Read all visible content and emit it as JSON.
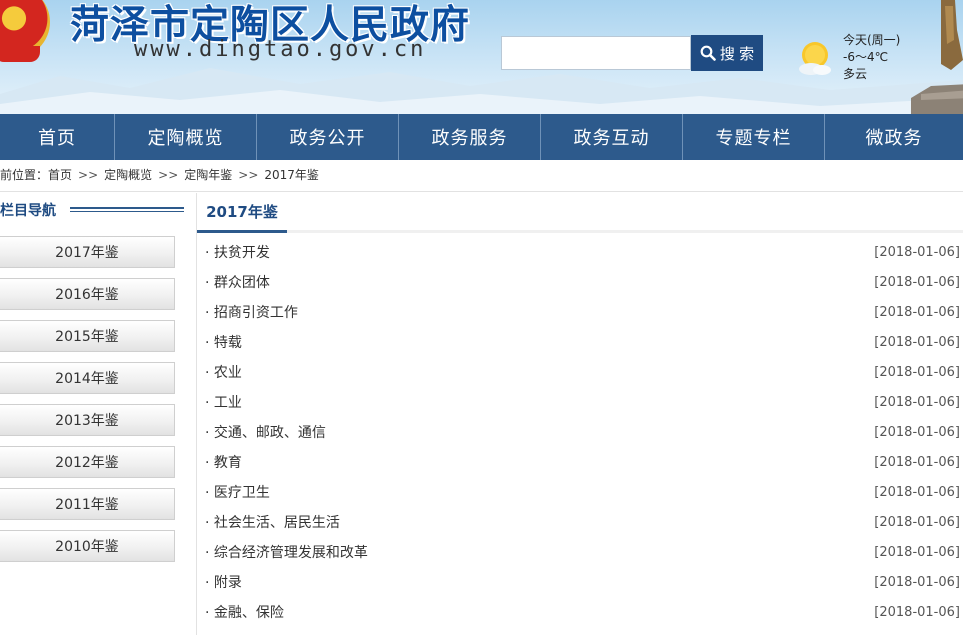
{
  "header": {
    "site_title": "菏泽市定陶区人民政府",
    "site_url": "www.dingtao.gov.cn",
    "search": {
      "placeholder": "",
      "button_label": "搜 索"
    },
    "weather": {
      "day": "今天(周一)",
      "temp": "-6～4℃",
      "condition": "多云",
      "icon": "partly-cloudy-sun-icon"
    }
  },
  "nav": {
    "items": [
      {
        "label": "首页"
      },
      {
        "label": "定陶概览"
      },
      {
        "label": "政务公开"
      },
      {
        "label": "政务服务"
      },
      {
        "label": "政务互动"
      },
      {
        "label": "专题专栏"
      },
      {
        "label": "微政务"
      }
    ]
  },
  "breadcrumb": {
    "prefix": "前位置：",
    "items": [
      "首页",
      "定陶概览",
      "定陶年鉴",
      "2017年鉴"
    ],
    "separator": ">>"
  },
  "sidebar": {
    "title": "栏目导航",
    "items": [
      {
        "label": "2017年鉴"
      },
      {
        "label": "2016年鉴"
      },
      {
        "label": "2015年鉴"
      },
      {
        "label": "2014年鉴"
      },
      {
        "label": "2013年鉴"
      },
      {
        "label": "2012年鉴"
      },
      {
        "label": "2011年鉴"
      },
      {
        "label": "2010年鉴"
      }
    ]
  },
  "main": {
    "tab_title": "2017年鉴",
    "articles": [
      {
        "title": "· 扶贫开发",
        "date": "[2018-01-06]"
      },
      {
        "title": "· 群众团体",
        "date": "[2018-01-06]"
      },
      {
        "title": "· 招商引资工作",
        "date": "[2018-01-06]"
      },
      {
        "title": "· 特载",
        "date": "[2018-01-06]"
      },
      {
        "title": "· 农业",
        "date": "[2018-01-06]"
      },
      {
        "title": "· 工业",
        "date": "[2018-01-06]"
      },
      {
        "title": "· 交通、邮政、通信",
        "date": "[2018-01-06]"
      },
      {
        "title": "· 教育",
        "date": "[2018-01-06]"
      },
      {
        "title": "· 医疗卫生",
        "date": "[2018-01-06]"
      },
      {
        "title": "· 社会生活、居民生活",
        "date": "[2018-01-06]"
      },
      {
        "title": "· 综合经济管理发展和改革",
        "date": "[2018-01-06]"
      },
      {
        "title": "· 附录",
        "date": "[2018-01-06]"
      },
      {
        "title": "· 金融、保险",
        "date": "[2018-01-06]"
      }
    ]
  },
  "colors": {
    "nav_bg": "#2d5a8c",
    "title_blue": "#0d4fa0",
    "search_button": "#1f4b82"
  }
}
